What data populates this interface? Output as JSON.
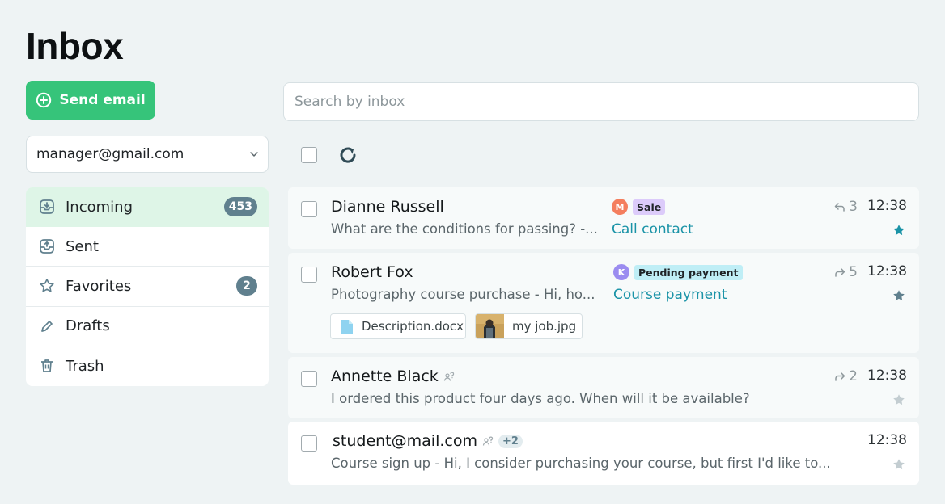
{
  "page_title": "Inbox",
  "send_button": {
    "label": "Send email",
    "icon": "plus-circle-icon"
  },
  "search": {
    "placeholder": "Search by inbox",
    "value": ""
  },
  "account": {
    "selected": "manager@gmail.com"
  },
  "sidebar": {
    "items": [
      {
        "label": "Incoming",
        "badge": "453",
        "icon": "inbox-icon",
        "active": true
      },
      {
        "label": "Sent",
        "badge": "",
        "icon": "sent-icon",
        "active": false
      },
      {
        "label": "Favorites",
        "badge": "2",
        "icon": "star-icon",
        "active": false
      },
      {
        "label": "Drafts",
        "badge": "",
        "icon": "pencil-icon",
        "active": false
      },
      {
        "label": "Trash",
        "badge": "",
        "icon": "trash-icon",
        "active": false
      }
    ]
  },
  "emails": [
    {
      "sender": "Dianne Russell",
      "preview": "What are the conditions for passing? -...",
      "avatar": "M",
      "tag": "Sale",
      "link": "Call contact",
      "count": "3",
      "count_icon": "reply-icon",
      "time": "12:38",
      "starred": true
    },
    {
      "sender": "Robert Fox",
      "preview": "Photography course purchase - Hi, ho...",
      "avatar": "K",
      "tag": "Pending payment",
      "link": "Course payment",
      "count": "5",
      "count_icon": "forward-icon",
      "time": "12:38",
      "starred": false,
      "attachments": [
        {
          "name": "Description.docx",
          "icon": "document-icon"
        },
        {
          "name": "my job.jpg",
          "icon": "image-thumbnail"
        }
      ]
    },
    {
      "sender": "Annette Black",
      "preview": "I ordered this product four days ago. When will it be available?",
      "count": "2",
      "count_icon": "forward-icon",
      "time": "12:38",
      "starred": false
    },
    {
      "sender": "student@mail.com",
      "recipients_extra": "+2",
      "preview": "Course sign up - Hi, I consider purchasing your course, but first I'd like to...",
      "time": "12:38",
      "starred": false
    }
  ],
  "colors": {
    "accent_green": "#36c47a",
    "link_teal": "#1a93a7",
    "badge_slate": "#60808e",
    "tag_sale": "#dccbfa",
    "tag_pending": "#bfeef6",
    "avatar_m": "#f47e5e",
    "avatar_k": "#9b8cf0"
  }
}
